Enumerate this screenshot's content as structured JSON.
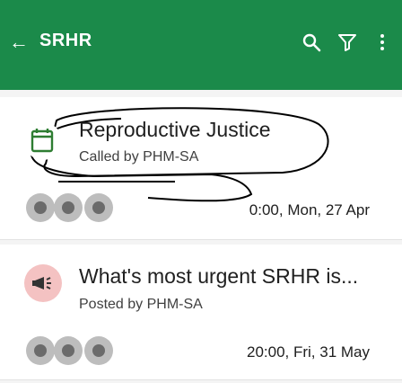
{
  "appbar": {
    "back_icon": "arrow-back-icon",
    "title": "SRHR",
    "search_icon": "search-icon",
    "filter_icon": "filter-icon",
    "menu_icon": "more-vert-icon",
    "color": "#1b8a4a"
  },
  "items": [
    {
      "title": "Reproductive Justice",
      "subtitle": "Called by PHM-SA",
      "meta": "0:00, Mon, 27 Apr",
      "category_icon": "calendar-icon",
      "category_color": "#2e7d32"
    },
    {
      "title": "What's most urgent SRHR is...",
      "subtitle": "Posted by PHM-SA",
      "meta": "20:00, Fri, 31 May",
      "category_icon": "megaphone-icon",
      "category_color": "#f4c2c2"
    }
  ]
}
